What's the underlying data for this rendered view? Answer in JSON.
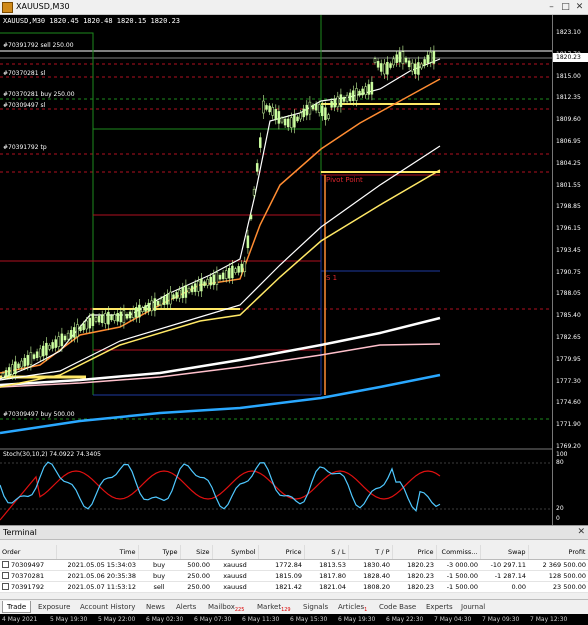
{
  "window": {
    "title": "XAUUSD,M30"
  },
  "chart": {
    "symbol_label": "XAUUSD,M30  1820.45 1820.48 1820.15 1820.23",
    "current_price": "1820.23",
    "order_labels": [
      "#70391792 sell 250.00",
      "#70370281 sl",
      "#70370281 buy 250.00",
      "#70309497 sl",
      "#70391792 tp",
      "#70309497 buy 500.00"
    ],
    "pivot_label": "Pivot Point",
    "s1_label": "S 1",
    "price_ticks": [
      "1823.10",
      "1817.70",
      "1815.00",
      "1812.35",
      "1809.60",
      "1806.95",
      "1804.25",
      "1801.55",
      "1798.85",
      "1796.15",
      "1793.45",
      "1790.75",
      "1788.05",
      "1785.40",
      "1782.65",
      "1779.95",
      "1777.30",
      "1774.60",
      "1771.90",
      "1769.20"
    ],
    "stoch_label": "Stoch(30,10,2) 74.0922 74.3405",
    "stoch_ticks": [
      "100",
      "80",
      "20",
      "0"
    ],
    "colors": {
      "bull_candle": "#ccffa0",
      "ma_white": "#ffffff",
      "ma_orange": "#ff8c32",
      "ma_yellow": "#ffe866",
      "ma_pink": "#ffc0cb",
      "ma_blue": "#2aa8ff",
      "level_red": "#b01020",
      "level_green": "#1e8a1e",
      "stoch_main": "#4fc8ff",
      "stoch_signal": "#e01010"
    }
  },
  "terminal": {
    "title": "Terminal",
    "columns": [
      "Order",
      "Time",
      "Type",
      "Size",
      "Symbol",
      "Price",
      "S / L",
      "T / P",
      "Price",
      "Commiss...",
      "Swap",
      "Profit"
    ],
    "orders": [
      {
        "order": "70309497",
        "time": "2021.05.05 15:34:03",
        "type": "buy",
        "size": "500.00",
        "symbol": "xauusd",
        "price": "1772.84",
        "sl": "1813.53",
        "tp": "1830.40",
        "cur": "1820.23",
        "commission": "-3 000.00",
        "swap": "-10 297.11",
        "profit": "2 369 500.00"
      },
      {
        "order": "70370281",
        "time": "2021.05.06 20:35:38",
        "type": "buy",
        "size": "250.00",
        "symbol": "xauusd",
        "price": "1815.09",
        "sl": "1817.80",
        "tp": "1828.40",
        "cur": "1820.23",
        "commission": "-1 500.00",
        "swap": "-1 287.14",
        "profit": "128 500.00"
      },
      {
        "order": "70391792",
        "time": "2021.05.07 11:53:12",
        "type": "sell",
        "size": "250.00",
        "symbol": "xauusd",
        "price": "1821.42",
        "sl": "1821.04",
        "tp": "1808.20",
        "cur": "1820.23",
        "commission": "-1 500.00",
        "swap": "0.00",
        "profit": "23 500.00"
      }
    ],
    "tabs": [
      {
        "label": "Trade",
        "badge": ""
      },
      {
        "label": "Exposure",
        "badge": ""
      },
      {
        "label": "Account History",
        "badge": ""
      },
      {
        "label": "News",
        "badge": ""
      },
      {
        "label": "Alerts",
        "badge": ""
      },
      {
        "label": "Mailbox",
        "badge": "225"
      },
      {
        "label": "Market",
        "badge": "129"
      },
      {
        "label": "Signals",
        "badge": ""
      },
      {
        "label": "Articles",
        "badge": "1"
      },
      {
        "label": "Code Base",
        "badge": ""
      },
      {
        "label": "Experts",
        "badge": ""
      },
      {
        "label": "Journal",
        "badge": ""
      }
    ],
    "time_ticks": [
      "4 May 2021",
      "5 May 19:30",
      "5 May 22:00",
      "6 May 02:30",
      "6 May 07:30",
      "6 May 11:30",
      "6 May 15:30",
      "6 May 19:30",
      "6 May 22:30",
      "7 May 04:30",
      "7 May 09:30",
      "7 May 12:30"
    ]
  }
}
